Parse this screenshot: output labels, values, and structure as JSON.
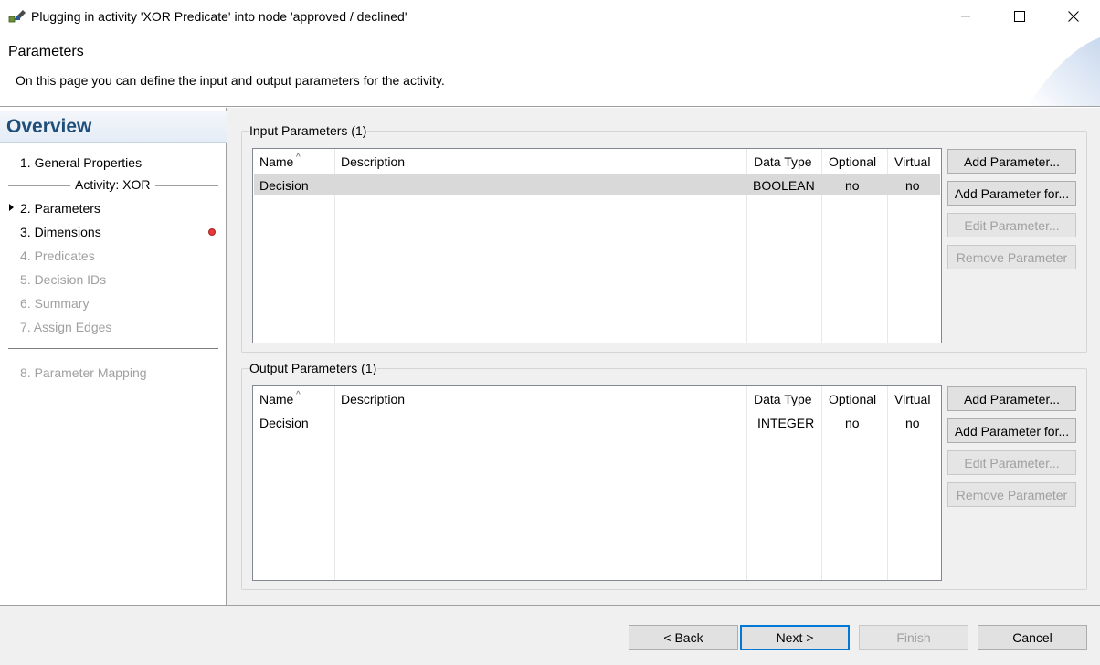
{
  "window": {
    "title": "Plugging in activity 'XOR Predicate' into node 'approved / declined'",
    "app_icon": "wizard-plug-icon",
    "controls": [
      "minimize-icon",
      "maximize-icon",
      "close-icon"
    ]
  },
  "header": {
    "title": "Parameters",
    "description": "On this page you can define the input and output parameters for the activity."
  },
  "sidebar": {
    "title": "Overview",
    "items": [
      {
        "label": "1. General Properties",
        "state": "normal"
      },
      {
        "label": "2. Parameters",
        "state": "current"
      },
      {
        "label": "3. Dimensions",
        "state": "error"
      },
      {
        "label": "4. Predicates",
        "state": "disabled"
      },
      {
        "label": "5. Decision IDs",
        "state": "disabled"
      },
      {
        "label": "6. Summary",
        "state": "disabled"
      },
      {
        "label": "7. Assign Edges",
        "state": "disabled"
      },
      {
        "label": "8. Parameter Mapping",
        "state": "disabled"
      }
    ],
    "group_label": "Activity: XOR"
  },
  "input_params": {
    "title": "Input Parameters (1)",
    "columns": [
      "Name",
      "Description",
      "Data Type",
      "Optional",
      "Virtual"
    ],
    "rows": [
      {
        "name": "Decision",
        "description": "",
        "data_type": "BOOLEAN",
        "optional": "no",
        "virtual": "no",
        "selected": true
      }
    ],
    "buttons": {
      "add": "Add Parameter...",
      "add_for": "Add Parameter for...",
      "edit": "Edit Parameter...",
      "remove": "Remove Parameter"
    }
  },
  "output_params": {
    "title": "Output Parameters (1)",
    "columns": [
      "Name",
      "Description",
      "Data Type",
      "Optional",
      "Virtual"
    ],
    "rows": [
      {
        "name": "Decision",
        "description": "",
        "data_type": "INTEGER",
        "optional": "no",
        "virtual": "no",
        "selected": false
      }
    ],
    "buttons": {
      "add": "Add Parameter...",
      "add_for": "Add Parameter for...",
      "edit": "Edit Parameter...",
      "remove": "Remove Parameter"
    }
  },
  "footer": {
    "back": "< Back",
    "next": "Next >",
    "finish": "Finish",
    "cancel": "Cancel"
  },
  "colors": {
    "accent": "#0078d7",
    "overview_title": "#1f4e79",
    "error": "#e03c3c",
    "disabled_text": "#a0a0a0"
  }
}
